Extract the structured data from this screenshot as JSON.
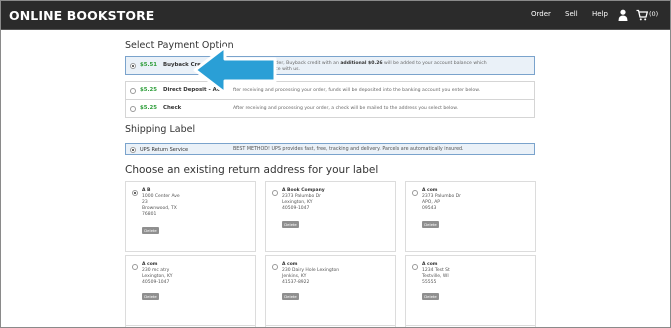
{
  "header": {
    "logo": "ONLINE BOOKSTORE",
    "nav": [
      "Order",
      "Sell",
      "Help"
    ],
    "cart_count": "(0)",
    "bg_color": "#2b2b2b"
  },
  "payment": {
    "title": "Select Payment Option",
    "options": [
      {
        "price": "$5.51",
        "name": "Buyback Credit",
        "desc_before": "processing your order, Buyback credit with an ",
        "desc_bold": "additional $0.26",
        "desc_after": " will be added to your account balance which",
        "desc_line2": "next order you place with us.",
        "selected": true
      },
      {
        "price": "$5.25",
        "name": "Direct Deposit - ACH",
        "desc": "fter receiving and processing your order, funds will be deposited into the banking account you enter below.",
        "selected": false
      },
      {
        "price": "$5.25",
        "name": "Check",
        "desc": "After receiving and processing your order, a check will be mailed to the address you select below.",
        "selected": false
      }
    ],
    "price_color": "#2e9e3a",
    "selected_bg": "#eaf1f8"
  },
  "shipping": {
    "title": "Shipping Label",
    "option_name": "UPS Return Service",
    "option_desc": "BEST METHOD! UPS provides fast, free, tracking and delivery. Parcels are automatically insured."
  },
  "addresses": {
    "title": "Choose an existing return address for your label",
    "delete_label": "Delete",
    "items": [
      {
        "name": "A B",
        "lines": [
          "1000 Center Ave",
          "23",
          "Brownwood, TX",
          "76801"
        ],
        "selected": true
      },
      {
        "name": "A Book Company",
        "lines": [
          "2373 Palumbo Dr",
          "Lexington, KY",
          "40509-1047"
        ],
        "selected": false
      },
      {
        "name": "A com",
        "lines": [
          "2373 Palumbo Dr",
          "APO, AP",
          "09543"
        ],
        "selected": false
      },
      {
        "name": "A com",
        "lines": [
          "230 mc atry",
          "Lexington, KY",
          "40509-1047"
        ],
        "selected": false
      },
      {
        "name": "A com",
        "lines": [
          "230 Dairy Hole Lexington",
          "Jenkins, KY",
          "41537-8922"
        ],
        "selected": false
      },
      {
        "name": "A com",
        "lines": [
          "1234 Test St",
          "Testville, WI",
          "55555"
        ],
        "selected": false
      }
    ]
  },
  "annotation": {
    "icon": "arrow-pointer-icon",
    "color": "#2a9fd6"
  }
}
